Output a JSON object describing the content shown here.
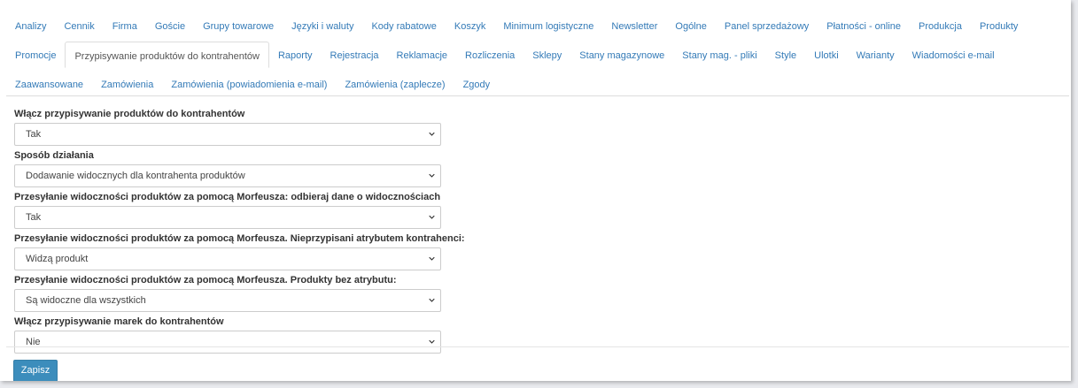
{
  "tabs": {
    "row1": [
      "Analizy",
      "Cennik",
      "Firma",
      "Goście",
      "Grupy towarowe",
      "Języki i waluty",
      "Kody rabatowe",
      "Koszyk",
      "Minimum logistyczne",
      "Newsletter",
      "Ogólne",
      "Panel sprzedażowy",
      "Płatności - online",
      "Produkcja",
      "Produkty"
    ],
    "row2": [
      "Promocje",
      "Przypisywanie produktów do kontrahentów",
      "Raporty",
      "Rejestracja",
      "Reklamacje",
      "Rozliczenia",
      "Sklepy",
      "Stany magazynowe",
      "Stany mag. - pliki",
      "Style",
      "Ulotki",
      "Warianty",
      "Wiadomości e-mail"
    ],
    "row3": [
      "Zaawansowane",
      "Zamówienia",
      "Zamówienia (powiadomienia e-mail)",
      "Zamówienia (zaplecze)",
      "Zgody"
    ],
    "active": "Przypisywanie produktów do kontrahentów"
  },
  "form": {
    "fields": [
      {
        "label": "Włącz przypisywanie produktów do kontrahentów",
        "value": "Tak"
      },
      {
        "label": "Sposób działania",
        "value": "Dodawanie widocznych dla kontrahenta produktów"
      },
      {
        "label": "Przesyłanie widoczności produktów za pomocą Morfeusza: odbieraj dane o widocznościach",
        "value": "Tak"
      },
      {
        "label": "Przesyłanie widoczności produktów za pomocą Morfeusza. Nieprzypisani atrybutem kontrahenci:",
        "value": "Widzą produkt"
      },
      {
        "label": "Przesyłanie widoczności produktów za pomocą Morfeusza. Produkty bez atrybutu:",
        "value": "Są widoczne dla wszystkich"
      },
      {
        "label": "Włącz przypisywanie marek do kontrahentów",
        "value": "Nie"
      }
    ]
  },
  "save_label": "Zapisz",
  "colors": {
    "link": "#337ab7",
    "button": "#3c8dbc",
    "background": "#e9eaee"
  }
}
